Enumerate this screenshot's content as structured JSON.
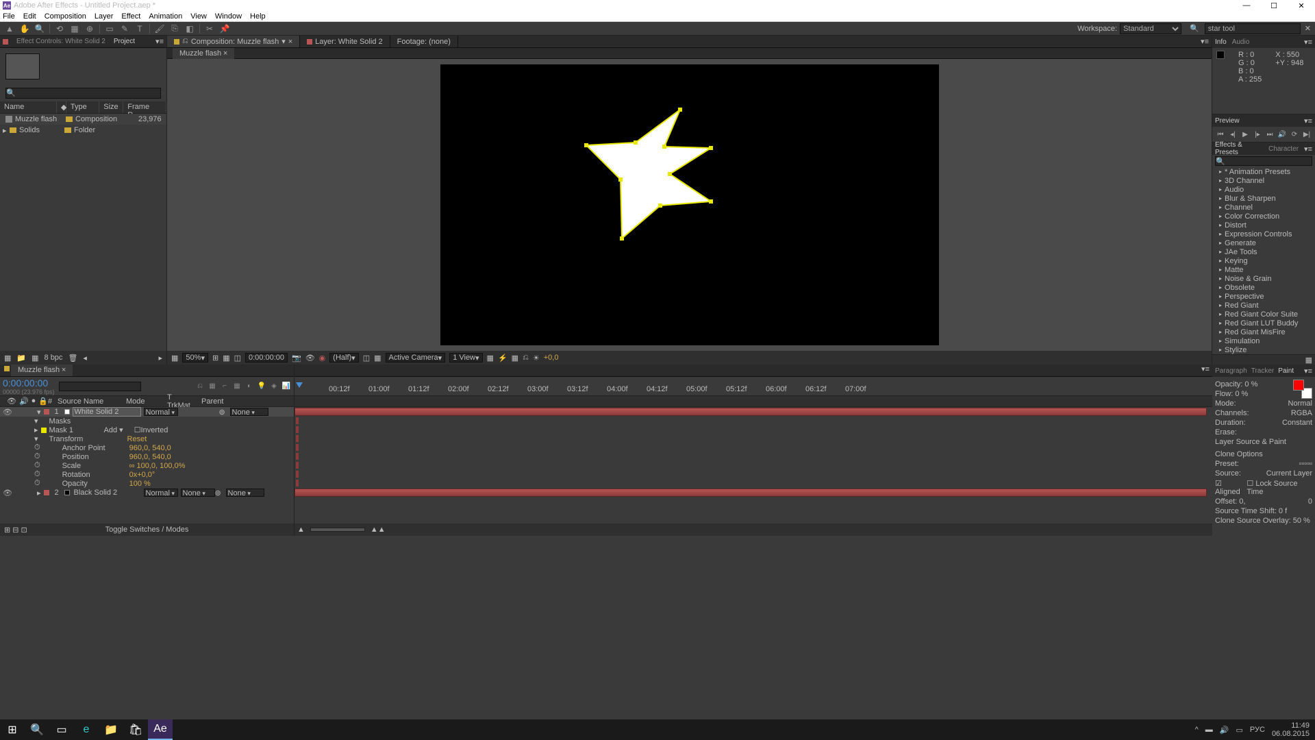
{
  "window": {
    "title": "Adobe After Effects - Untitled Project.aep *",
    "app_abbr": "Ae"
  },
  "menu": [
    "File",
    "Edit",
    "Composition",
    "Layer",
    "Effect",
    "Animation",
    "View",
    "Window",
    "Help"
  ],
  "workspace": {
    "label": "Workspace:",
    "value": "Standard"
  },
  "search": {
    "placeholder": "star tool"
  },
  "project": {
    "effect_controls_tab": "Effect Controls: White Solid 2",
    "project_tab": "Project",
    "columns": {
      "name": "Name",
      "type": "Type",
      "size": "Size",
      "framerate": "Frame R..."
    },
    "items": [
      {
        "name": "Muzzle flash",
        "type": "Composition",
        "framerate": "23,976"
      },
      {
        "name": "Solids",
        "type": "Folder",
        "framerate": ""
      }
    ],
    "bpc": "8 bpc"
  },
  "comp": {
    "tab_label": "Composition: Muzzle flash",
    "layer_tab": "Layer: White Solid 2",
    "footage_tab": "Footage: (none)",
    "name_tab": "Muzzle flash",
    "zoom": "50%",
    "time": "0:00:00:00",
    "resolution": "(Half)",
    "camera": "Active Camera",
    "views": "1 View",
    "exposure": "+0,0"
  },
  "info": {
    "tab1": "Info",
    "tab2": "Audio",
    "r": "R : 0",
    "g": "G : 0",
    "b": "B : 0",
    "a": "A : 255",
    "x": "X : 550",
    "y": "Y : 948"
  },
  "preview": {
    "tab": "Preview"
  },
  "effects": {
    "tab1": "Effects & Presets",
    "tab2": "Character",
    "categories": [
      "* Animation Presets",
      "3D Channel",
      "Audio",
      "Blur & Sharpen",
      "Channel",
      "Color Correction",
      "Distort",
      "Expression Controls",
      "Generate",
      "JAe Tools",
      "Keying",
      "Matte",
      "Noise & Grain",
      "Obsolete",
      "Perspective",
      "Red Giant",
      "Red Giant Color Suite",
      "Red Giant LUT Buddy",
      "Red Giant MisFire",
      "Simulation",
      "Stylize"
    ]
  },
  "timeline": {
    "tab": "Muzzle flash",
    "timecode": "0:00:00:00",
    "subtime": "00000 (23.976 fps)",
    "cols": {
      "num": "#",
      "source": "Source Name",
      "mode": "Mode",
      "trkmat": "TrkMat",
      "parent": "Parent"
    },
    "layers": [
      {
        "num": "1",
        "name": "White Solid 2",
        "mode": "Normal",
        "parent": "None",
        "color": "#b85555"
      },
      {
        "num": "2",
        "name": "Black Solid 2",
        "mode": "Normal",
        "trkmat": "None",
        "parent": "None",
        "color": "#b85555"
      }
    ],
    "props": {
      "masks": "Masks",
      "mask1": "Mask 1",
      "mask_mode": "Add",
      "inverted": "Inverted",
      "transform": "Transform",
      "reset": "Reset",
      "anchor": "Anchor Point",
      "anchor_val": "960,0, 540,0",
      "position": "Position",
      "position_val": "960,0, 540,0",
      "scale": "Scale",
      "scale_val": "∞ 100,0, 100,0%",
      "rotation": "Rotation",
      "rotation_val": "0x+0,0°",
      "opacity": "Opacity",
      "opacity_val": "100 %"
    },
    "ruler": [
      "00:12f",
      "01:00f",
      "01:12f",
      "02:00f",
      "02:12f",
      "03:00f",
      "03:12f",
      "04:00f",
      "04:12f",
      "05:00f",
      "05:12f",
      "06:00f",
      "06:12f",
      "07:00f"
    ],
    "toggle": "Toggle Switches / Modes"
  },
  "paint": {
    "tab1": "Paragraph",
    "tab2": "Tracker",
    "tab3": "Paint",
    "opacity": "Opacity: 0 %",
    "flow": "Flow: 0 %",
    "mode": "Mode:",
    "mode_val": "Normal",
    "channels": "Channels:",
    "channels_val": "RGBA",
    "duration": "Duration:",
    "duration_val": "Constant",
    "erase": "Erase:",
    "erase_val": "Layer Source & Paint",
    "clone": "Clone Options",
    "preset": "Preset:",
    "source": "Source:",
    "source_val": "Current Layer",
    "aligned": "Aligned",
    "lock": "Lock Source Time",
    "offset": "Offset: 0,",
    "offset2": "0",
    "timeshift": "Source Time Shift: 0  f",
    "overlay": "Clone Source Overlay:  50 %"
  },
  "taskbar": {
    "time": "11:49",
    "date": "06.08.2015",
    "lang": "РУС"
  }
}
